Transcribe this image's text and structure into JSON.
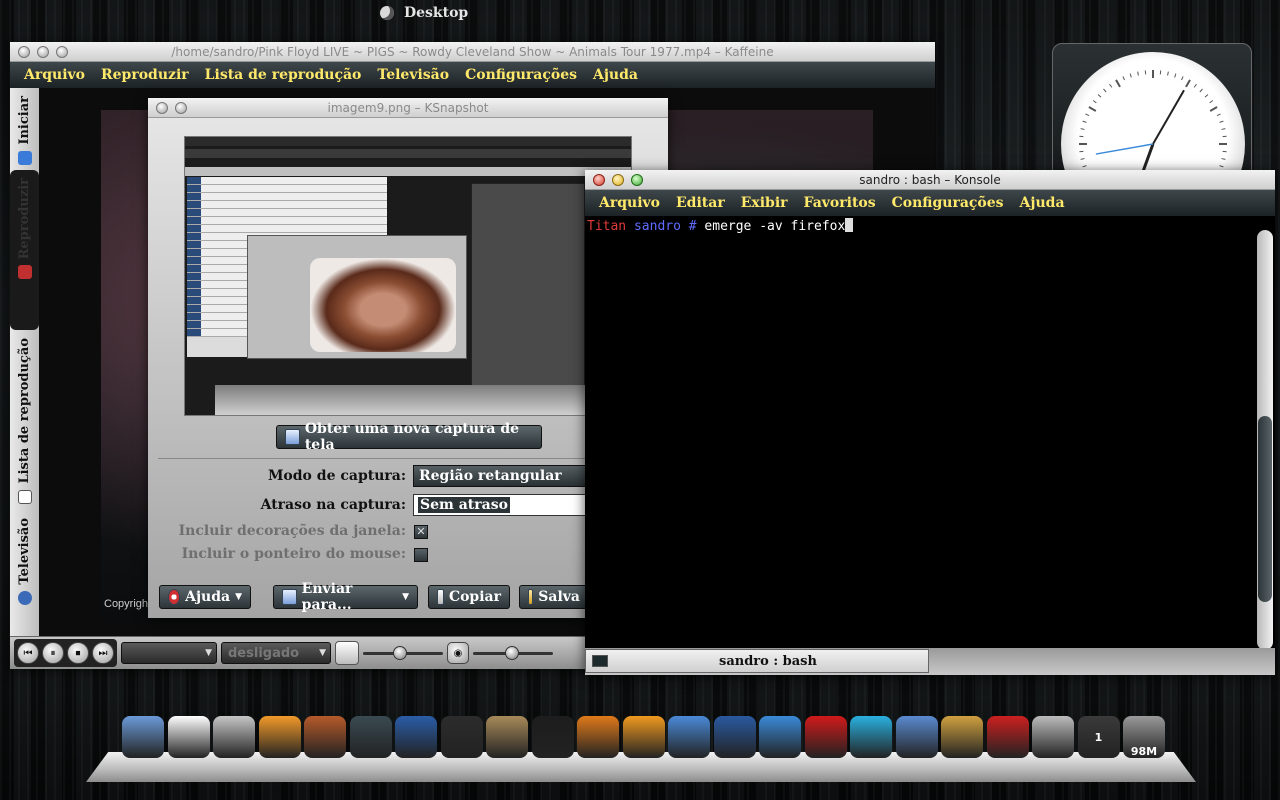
{
  "desktop": {
    "label": "Desktop"
  },
  "kaffeine": {
    "title": "/home/sandro/Pink Floyd LIVE ~ PIGS ~ Rowdy Cleveland Show ~ Animals Tour 1977.mp4 – Kaffeine",
    "menu": [
      "Arquivo",
      "Reproduzir",
      "Lista de reprodução",
      "Televisão",
      "Configurações",
      "Ajuda"
    ],
    "side_tabs": [
      "Iniciar",
      "Reproduzir",
      "Lista de reprodução",
      "Televisão"
    ],
    "copyright": "Copyright",
    "controls": {
      "combo1": "",
      "combo2": "desligado",
      "seek_level": 0.48,
      "volume_level": 0.45
    }
  },
  "ksnapshot": {
    "title": "imagem9.png – KSnapshot",
    "new_capture_button": "Obter uma nova captura de tela",
    "mode_label": "Modo de captura:",
    "mode_value": "Região retangular",
    "delay_label": "Atraso na captura:",
    "delay_value": "Sem atraso",
    "include_decorations_label": "Incluir decorações da janela:",
    "include_decorations_checked": true,
    "include_pointer_label": "Incluir o ponteiro do mouse:",
    "include_pointer_checked": false,
    "help_button": "Ajuda",
    "send_button": "Enviar para...",
    "copy_button": "Copiar",
    "save_button": "Salva"
  },
  "konsole": {
    "title": "sandro : bash – Konsole",
    "menu": [
      "Arquivo",
      "Editar",
      "Exibir",
      "Favoritos",
      "Configurações",
      "Ajuda"
    ],
    "prompt_host": "Titan",
    "prompt_user": "sandro",
    "prompt_symbol": "#",
    "command": "emerge -av firefox",
    "tab_label": "sandro : bash"
  },
  "clock": {
    "hour_deg": 200,
    "minute_deg": 30,
    "second_deg": 260
  },
  "dock": {
    "items": [
      {
        "name": "finder-icon",
        "color": "#6b9ad8"
      },
      {
        "name": "document-icon",
        "color": "#ffffff"
      },
      {
        "name": "media-tools-icon",
        "color": "#c6c6c6"
      },
      {
        "name": "orange-slices-icon",
        "color": "#f39a2a"
      },
      {
        "name": "coffee-cup-icon",
        "color": "#b65a2a"
      },
      {
        "name": "time-machine-icon",
        "color": "#3a4a52"
      },
      {
        "name": "system-monitor-icon",
        "color": "#2a5da8"
      },
      {
        "name": "terminal-panel-icon",
        "color": "#2c2c2c"
      },
      {
        "name": "gimp-icon",
        "color": "#a88a5a"
      },
      {
        "name": "steam-icon",
        "color": "#1d1d1d"
      },
      {
        "name": "chess-icon",
        "color": "#e07a1a"
      },
      {
        "name": "rss-icon",
        "color": "#f09a20"
      },
      {
        "name": "chrome-icon",
        "color": "#4a8ad8"
      },
      {
        "name": "thunderbird-icon",
        "color": "#2a5aa0"
      },
      {
        "name": "safari-icon",
        "color": "#3a8ad8"
      },
      {
        "name": "opera-icon",
        "color": "#d01a1a"
      },
      {
        "name": "skype-icon",
        "color": "#2ab0e0"
      },
      {
        "name": "virtualbox-icon",
        "color": "#5a8ad0"
      },
      {
        "name": "kolourpaint-icon",
        "color": "#d0a040"
      },
      {
        "name": "youtube-icon",
        "color": "#cc2020"
      },
      {
        "name": "mail-at-icon",
        "color": "#bcbcbc"
      },
      {
        "name": "workspace-switcher-icon",
        "color": "#3a3a3a"
      },
      {
        "name": "trash-icon",
        "color": "#9a9a9a"
      }
    ],
    "workspace_number": "1",
    "trash_size": "98M"
  }
}
